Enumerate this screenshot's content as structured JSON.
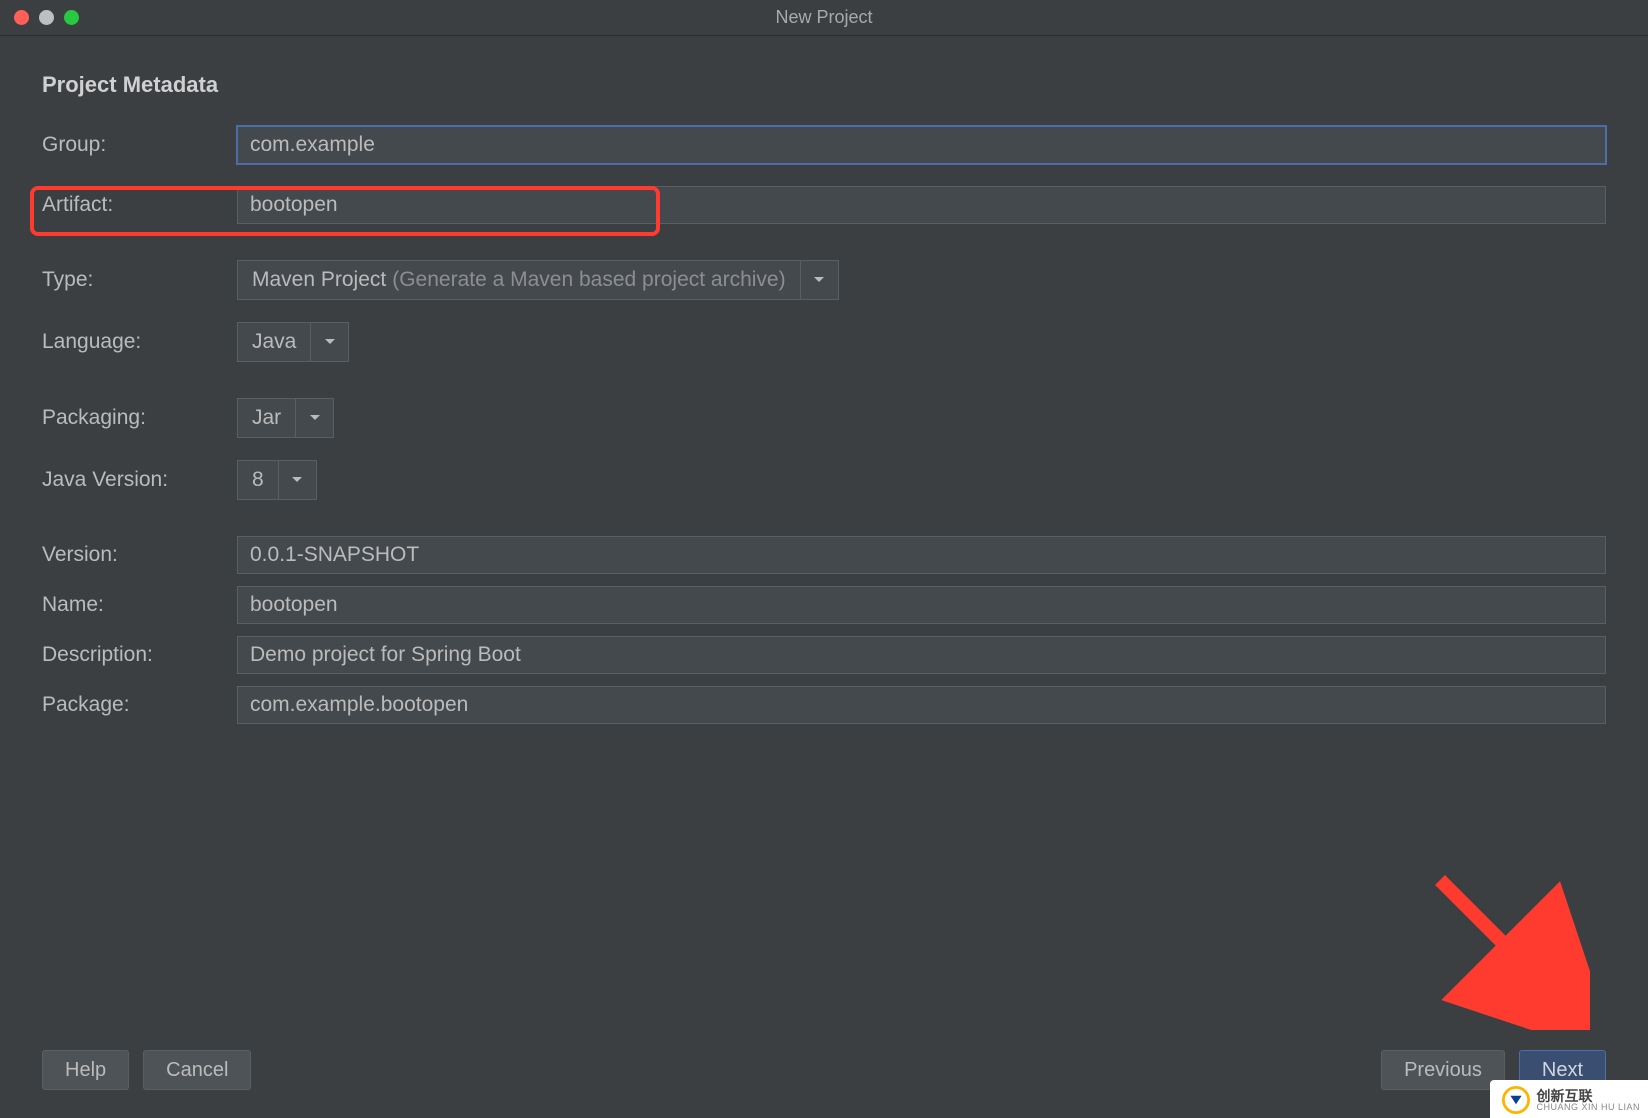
{
  "window": {
    "title": "New Project"
  },
  "section": {
    "title": "Project Metadata"
  },
  "labels": {
    "group": "Group:",
    "artifact": "Artifact:",
    "type": "Type:",
    "language": "Language:",
    "packaging": "Packaging:",
    "javaVersion": "Java Version:",
    "version": "Version:",
    "name": "Name:",
    "description": "Description:",
    "package": "Package:"
  },
  "values": {
    "group": "com.example",
    "artifact": "bootopen",
    "type_main": "Maven Project",
    "type_hint": "(Generate a Maven based project archive)",
    "language": "Java",
    "packaging": "Jar",
    "javaVersion": "8",
    "version": "0.0.1-SNAPSHOT",
    "name": "bootopen",
    "description": "Demo project for Spring Boot",
    "package": "com.example.bootopen"
  },
  "buttons": {
    "help": "Help",
    "cancel": "Cancel",
    "previous": "Previous",
    "next": "Next"
  },
  "watermark": {
    "main": "创新互联",
    "sub": "CHUANG XIN HU LIAN"
  },
  "colors": {
    "annotation_red": "#ff3b30",
    "accent_blue": "#4a6ea9",
    "button_primary_bg": "#394e70"
  }
}
